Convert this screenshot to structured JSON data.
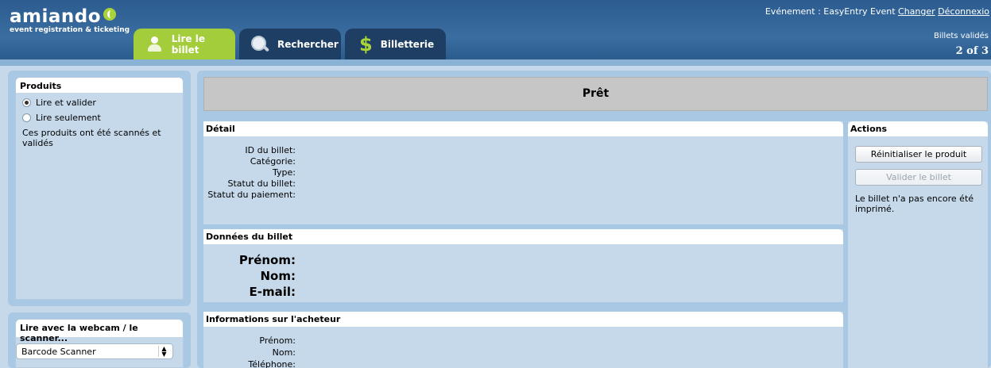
{
  "header": {
    "logo_text": "amiando",
    "logo_tagline": "event registration & ticketing",
    "event_prefix": "Evénement : EasyEntry Event",
    "change_link": "Changer",
    "logout_link": "Déconnexio",
    "validated_label": "Billets validés",
    "validated_count": "2 of 3",
    "tabs": [
      {
        "label": "Lire le billet",
        "icon": "person-icon",
        "active": true
      },
      {
        "label": "Rechercher",
        "icon": "magnifier-icon",
        "active": false
      },
      {
        "label": "Billetterie",
        "icon": "dollar-icon",
        "active": false
      }
    ]
  },
  "products": {
    "title": "Produits",
    "options": [
      {
        "label": "Lire et valider",
        "selected": true
      },
      {
        "label": "Lire seulement",
        "selected": false
      }
    ],
    "note": "Ces produits ont été scannés et validés"
  },
  "scanner": {
    "title": "Lire avec la webcam / le scanner...",
    "selected_value": "Barcode Scanner"
  },
  "status": {
    "text": "Prêt"
  },
  "detail": {
    "title": "Détail",
    "fields": [
      "ID du billet:",
      "Catégorie:",
      "Type:",
      "Statut du billet:",
      "Statut du paiement:"
    ]
  },
  "ticket_data": {
    "title": "Données du billet",
    "fields": [
      "Prénom:",
      "Nom:",
      "E-mail:"
    ]
  },
  "buyer": {
    "title": "Informations sur l'acheteur",
    "fields": [
      "Prénom:",
      "Nom:",
      "Téléphone:"
    ]
  },
  "actions": {
    "title": "Actions",
    "reset_button": "Réinitialiser le produit",
    "validate_button": "Valider le billet",
    "note": "Le billet n'a pas encore été imprimé."
  },
  "colors": {
    "header_blue": "#2c5c90",
    "active_tab_green": "#a4cd3c",
    "inactive_tab_navy": "#1e3f63",
    "panel_blue": "#c6d9eb",
    "status_gray": "#c6c6c6"
  }
}
